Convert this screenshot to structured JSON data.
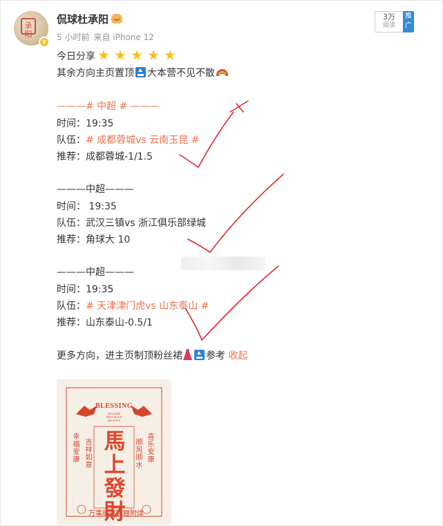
{
  "post": {
    "username": "侃球杜承阳",
    "user_badge_icon": "face-emoji-icon",
    "avatar_stamp": "承阳",
    "time": "5 小时前",
    "source": "来自 iPhone 12",
    "read_count": "3万",
    "read_label": "阅读",
    "promote_label": "推广",
    "intro_line1": "今日分享",
    "intro_line2_a": "其余方向主页置顶",
    "intro_line2_b": "大本营不见不散",
    "matches": [
      {
        "header": "———# 中超 # ———",
        "time_label": "时间：",
        "time_value": "19:35",
        "team_label": "队伍：",
        "team_value": "# 成都蓉城vs 云南玉昆 #",
        "pick_label": "推荐：",
        "pick_value": "成都蓉城-1/1.5"
      },
      {
        "header": "———中超———",
        "time_label": "时间：",
        "time_value": " 19:35",
        "team_label": "队伍：",
        "team_value": "武汉三镇vs 浙江俱乐部绿城",
        "pick_label": "推荐：",
        "pick_value": "角球大 10"
      },
      {
        "header": "———中超———",
        "time_label": "时间：",
        "time_value": "19:35",
        "team_label": "队伍：",
        "team_value": "# 天津津门虎vs 山东泰山 #",
        "pick_label": "推荐：",
        "pick_value": "山东泰山-0.5/1"
      }
    ],
    "more_a": "更多方向，进主页制顶粉丝裙",
    "more_b": "参考",
    "collapse_label": "收起"
  },
  "image": {
    "blessing": "BLESSING",
    "subtitle": "MASTER\nFRUGIOUS\nHEAVEN",
    "main_text": "馬上發財",
    "left_text": "幸福安康",
    "right_text": "喜乐安康",
    "inner_left": "吉祥如意",
    "inner_right": "顺风顺水",
    "bottom_left": "万事顺遂",
    "bottom_right": "锦鲤附体"
  },
  "colors": {
    "accent": "#eb7350",
    "check_marks": "#e0262b",
    "promote_bg": "#2f8bd6",
    "image_red": "#e1442c"
  }
}
